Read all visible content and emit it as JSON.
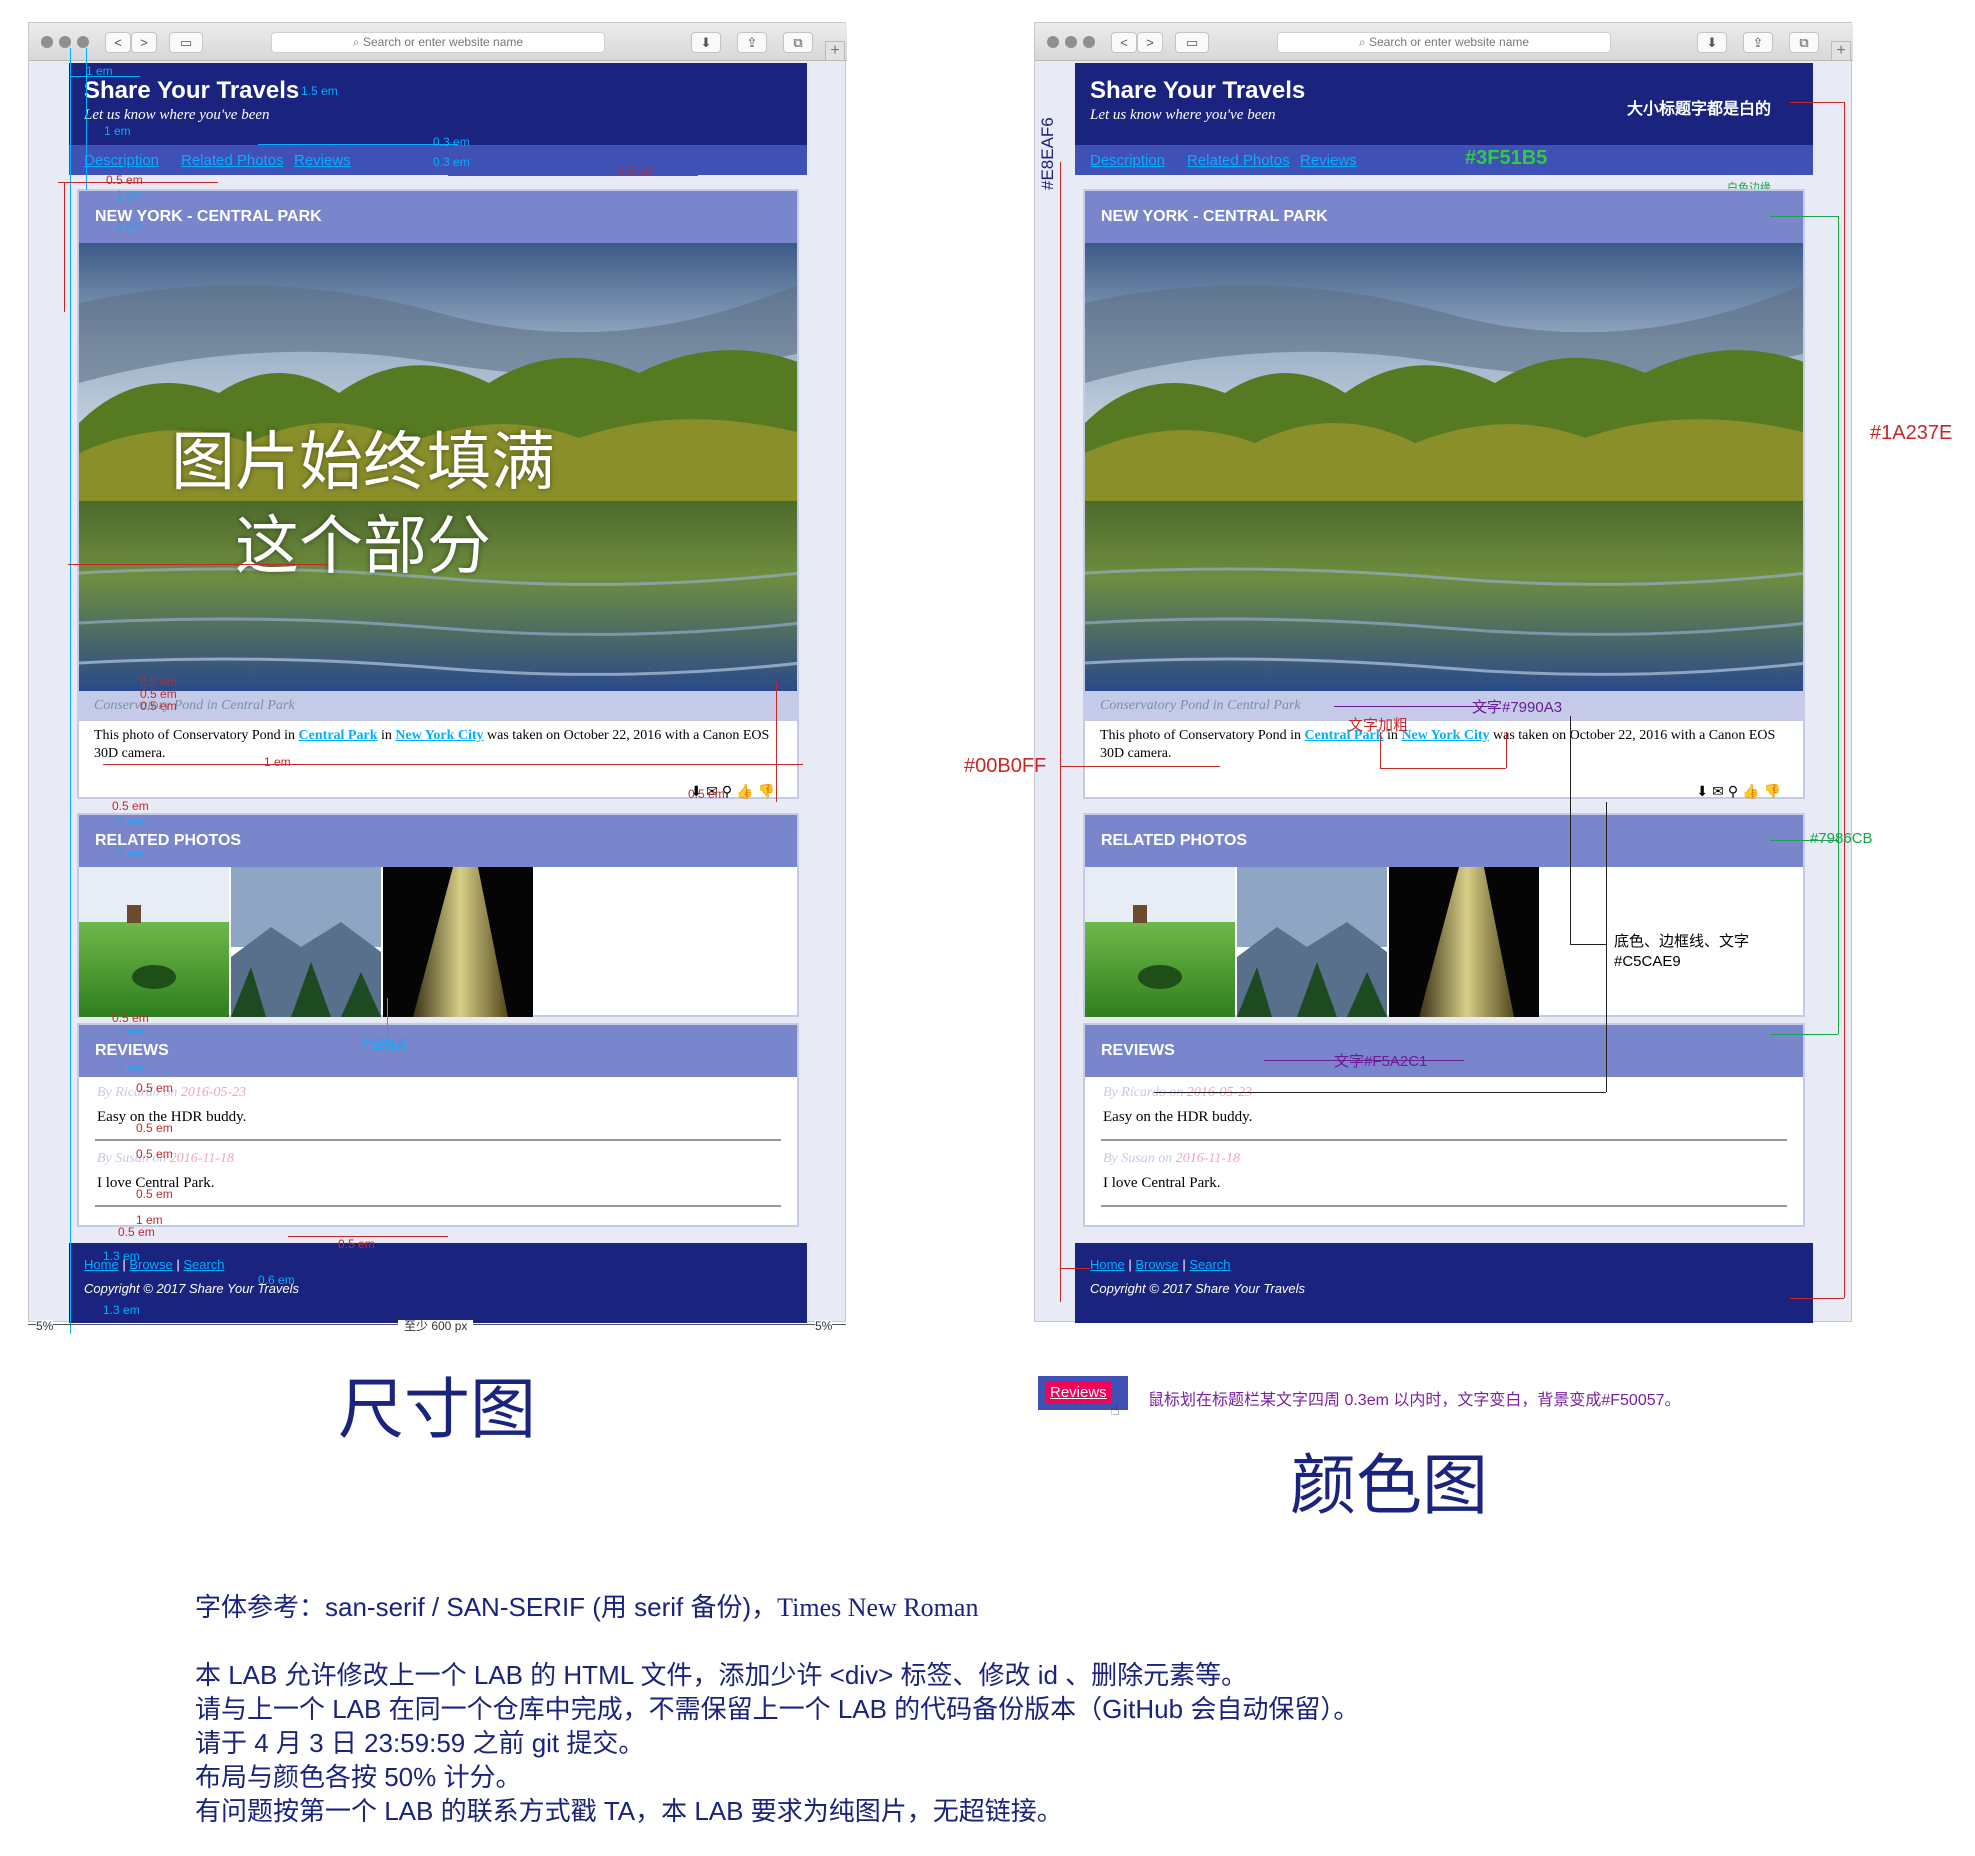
{
  "browser": {
    "address_placeholder": "Search or enter website name",
    "back_glyph": "<",
    "forward_glyph": ">",
    "new_tab_glyph": "+"
  },
  "site": {
    "title": "Share Your Travels",
    "subtitle": "Let us know where you've been",
    "nav": [
      "Description",
      "Related Photos",
      "Reviews"
    ],
    "photo_title": "NEW YORK - CENTRAL PARK",
    "caption": "Conservatory Pond in Central Park",
    "desc_before": "This photo of Conservatory Pond in ",
    "desc_link1": "Central Park",
    "desc_mid": " in ",
    "desc_link2": "New York City",
    "desc_after": " was taken on October 22, 2016 with a Canon EOS 30D camera.",
    "action_icons": "⬇✉⚲👍👎",
    "related_title": "RELATED PHOTOS",
    "reviews_title": "REVIEWS",
    "reviews": [
      {
        "by": "By Ricardo on",
        "date": "2016-05-23",
        "text": "Easy on the HDR buddy."
      },
      {
        "by": "By Susan on",
        "date": "2016-11-18",
        "text": "I love Central Park."
      }
    ],
    "footer_links": [
      "Home",
      "Browse",
      "Search"
    ],
    "footer_sep": "|",
    "copyright": "Copyright © 2017 Share Your Travels"
  },
  "left_panel": {
    "overlay_line1": "图片始终填满",
    "overlay_line2": "这个部分",
    "label": "尺寸图",
    "dims": {
      "em1": "1 em",
      "em15": "1.5 em",
      "em03": "0.3 em",
      "em05": "0.5 em",
      "em06": "0.6 em",
      "em13": "1.3 em",
      "space": "一个空格宽",
      "pct": "5%",
      "min_width": "至少 600 px"
    }
  },
  "right_panel": {
    "label": "颜色图",
    "header_note": "大小标题字都是白的",
    "nav_color": "#3F51B5",
    "white_border": "白色边缘",
    "bg_color": "#E8EAF6",
    "header_color": "#1A237E",
    "link_color": "#00B0FF",
    "bold_note": "文字加粗",
    "caption_color_note": "文字#7990A3",
    "section_color": "#7986CB",
    "c5_note_1": "底色、边框线、文字",
    "c5_note_2": "#C5CAE9",
    "date_color_note": "文字#F5A2C1",
    "hover_demo": "Reviews",
    "hover_note": "鼠标划在标题栏某文字四周 0.3em 以内时，文字变白，背景变成#F50057。"
  },
  "instructions": {
    "font_ref_prefix": "字体参考：san-serif / SAN-SERIF (用 serif 备份)，",
    "font_ref_serif": "Times New Roman",
    "lines": [
      "本 LAB 允许修改上一个 LAB 的 HTML 文件，添加少许 <div> 标签、修改 id 、删除元素等。",
      "请与上一个 LAB 在同一个仓库中完成，不需保留上一个 LAB 的代码备份版本（GitHub 会自动保留）。",
      "请于 4 月 3 日 23:59:59 之前 git 提交。",
      "布局与颜色各按 50% 计分。",
      "有问题按第一个 LAB 的联系方式戳 TA，本 LAB 要求为纯图片，无超链接。"
    ]
  }
}
